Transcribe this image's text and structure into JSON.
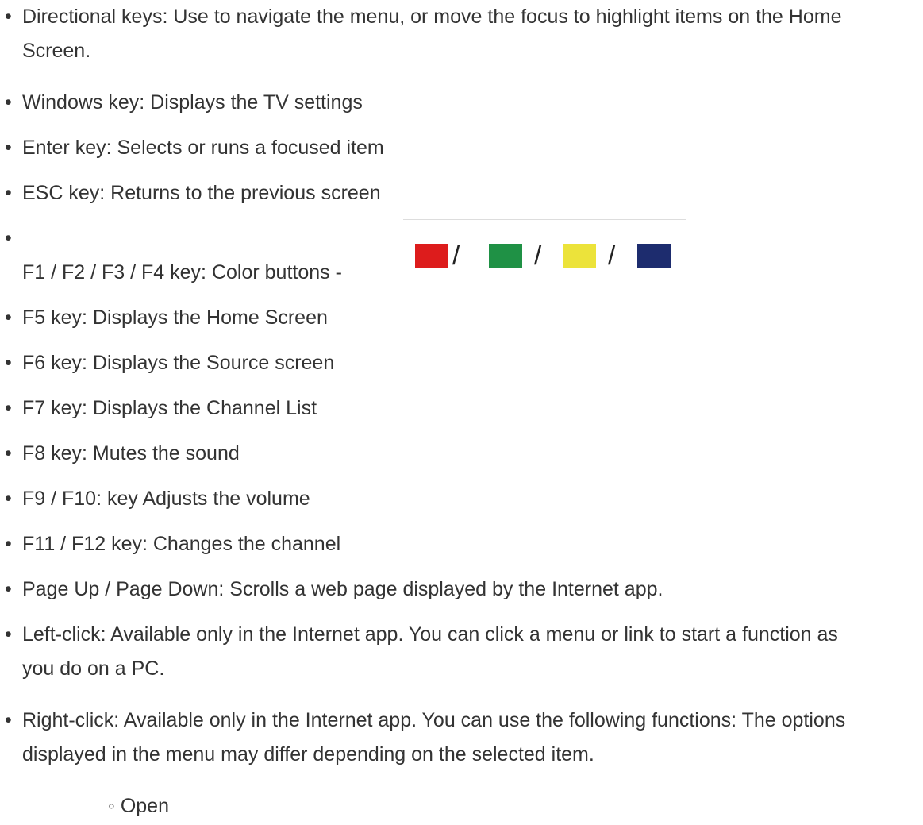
{
  "bullet_symbol": "•",
  "sub_bullet_symbol": "◦",
  "items": [
    {
      "text": "Directional keys: Use to navigate the menu, or move the focus to highlight items on the Home Screen."
    },
    {
      "text": "Windows key: Displays the TV settings"
    },
    {
      "text": "Enter key: Selects or runs a focused item"
    },
    {
      "text": "ESC key: Returns to the previous screen"
    },
    {
      "text": "F1 / F2 / F3 / F4 key: Color buttons -"
    },
    {
      "text": "F5 key: Displays the Home Screen"
    },
    {
      "text": "F6 key: Displays the Source screen"
    },
    {
      "text": "F7 key: Displays the Channel List"
    },
    {
      "text": "F8 key: Mutes the sound"
    },
    {
      "text": "F9 / F10: key Adjusts the volume"
    },
    {
      "text": "F11 / F12 key: Changes the channel"
    },
    {
      "text": "Page Up / Page Down: Scrolls a web page displayed by the Internet app."
    },
    {
      "text": "Left-click: Available only in the Internet app. You can click a menu or link to start a function as you do on a PC."
    },
    {
      "text": "Right-click: Available only in the Internet app. You can use the following functions: The options displayed in the menu may differ depending on the selected item."
    }
  ],
  "color_buttons": {
    "separator": "/",
    "colors": [
      "#dd1c1c",
      "#1f9145",
      "#ece33a",
      "#1d2c6e"
    ],
    "icon_names": [
      "red-button-icon",
      "green-button-icon",
      "yellow-button-icon",
      "blue-button-icon"
    ]
  },
  "sub_items": [
    {
      "text": "Open"
    }
  ]
}
